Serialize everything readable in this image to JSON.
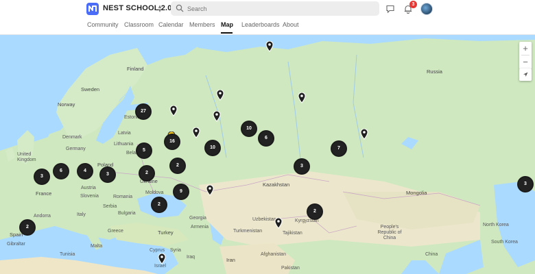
{
  "header": {
    "brand": "NEST SCHOOL 2.0",
    "search_placeholder": "Search",
    "notification_count": "3"
  },
  "nav": {
    "tabs": [
      {
        "label": "Community",
        "active": false
      },
      {
        "label": "Classroom",
        "active": false
      },
      {
        "label": "Calendar",
        "active": false
      },
      {
        "label": "Members",
        "active": false
      },
      {
        "label": "Map",
        "active": true
      },
      {
        "label": "Leaderboards",
        "active": false
      },
      {
        "label": "About",
        "active": false
      }
    ]
  },
  "map": {
    "zoom_in": "+",
    "zoom_out": "−",
    "labels": [
      "Finland",
      "Sweden",
      "Norway",
      "Russia",
      "Estonia",
      "Latvia",
      "Lithuania",
      "Denmark",
      "United Kingdom",
      "Belarus",
      "Poland",
      "Germany",
      "Ukraine",
      "France",
      "Austria",
      "Slovenia",
      "Romania",
      "Moldova",
      "Italy",
      "Serbia",
      "Bulgaria",
      "Andorra",
      "Spain",
      "Greece",
      "Turkey",
      "Syria",
      "Iraq",
      "Iran",
      "Georgia",
      "Armenia",
      "Kazakhstan",
      "Uzbekistan",
      "Turkmenistan",
      "Tajikistan",
      "Kyrgyzstan",
      "Afghanistan",
      "Pakistan",
      "Mongolia",
      "China",
      "People's Republic of China",
      "North Korea",
      "South Korea",
      "Tunisia",
      "Gibraltar",
      "Israel",
      "Cyprus",
      "Malta"
    ],
    "clusters": [
      "27",
      "5",
      "6",
      "4",
      "3",
      "3",
      "2",
      "2",
      "9",
      "2",
      "2",
      "10",
      "10",
      "6",
      "7",
      "3",
      "2",
      "3",
      "16"
    ],
    "pins": 11
  }
}
